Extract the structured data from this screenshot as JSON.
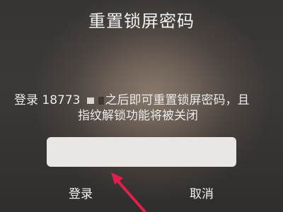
{
  "dialog": {
    "title": "重置锁屏密码",
    "message_line1_prefix": "登录 18773",
    "message_line1_suffix": "之后即可重置锁屏密码，且",
    "message_line2": "指纹解锁功能将被关闭",
    "input": {
      "value": "",
      "placeholder": ""
    },
    "buttons": {
      "login_label": "登录",
      "cancel_label": "取消"
    }
  },
  "colors": {
    "text": "#f2f2f2",
    "input_background": "#e9e6e3",
    "annotation_arrow": "#e0204a"
  },
  "icons": {
    "annotation": "red-arrow-icon"
  }
}
